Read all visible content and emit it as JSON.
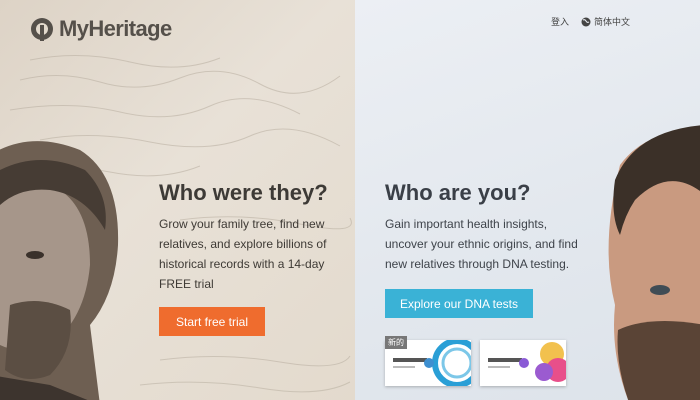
{
  "header": {
    "logo_text": "MyHeritage",
    "login": "登入",
    "language": "简体中文"
  },
  "left": {
    "title": "Who were they?",
    "text": "Grow your family tree, find new relatives, and explore billions of historical records with a 14-day FREE trial",
    "button": "Start free trial"
  },
  "right": {
    "title": "Who are you?",
    "text": "Gain important health insights, uncover your ethnic origins, and find new relatives through DNA testing.",
    "button": "Explore our DNA tests",
    "badge": "新的"
  },
  "colors": {
    "trial_button": "#ef6c2e",
    "dna_button": "#3ab2d6"
  }
}
